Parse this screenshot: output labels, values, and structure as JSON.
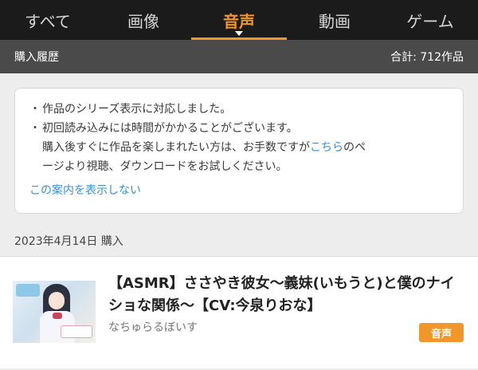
{
  "tabs": [
    {
      "label": "すべて"
    },
    {
      "label": "画像"
    },
    {
      "label": "音声"
    },
    {
      "label": "動画"
    },
    {
      "label": "ゲーム"
    }
  ],
  "active_tab": "音声",
  "subheader": {
    "title": "購入履歴",
    "total": "合計: 712作品"
  },
  "notice": {
    "line1": "作品のシリーズ表示に対応しました。",
    "line2": "初回読み込みには時間がかかることがございます。",
    "line3_before": "購入後すぐに作品を楽しまれたい方は、お手数ですが",
    "line3_link": "こちら",
    "line3_after": "のペ",
    "line4": "ージより視聴、ダウンロードをお試しください。",
    "hide_link": "この案内を表示しない"
  },
  "date_row": {
    "date": "2023年4月14日",
    "label": "購入"
  },
  "item": {
    "title": "【ASMR】ささやき彼女〜義妹(いもうと)と僕のナイショな関係〜【CV:今泉りおな】",
    "circle": "なちゅらるぼいす",
    "badge": "音声"
  },
  "colors": {
    "accent": "#f0962b",
    "tab_bar": "#1b1b1b",
    "subheader": "#4a4a4a",
    "link": "#3b8fce"
  }
}
